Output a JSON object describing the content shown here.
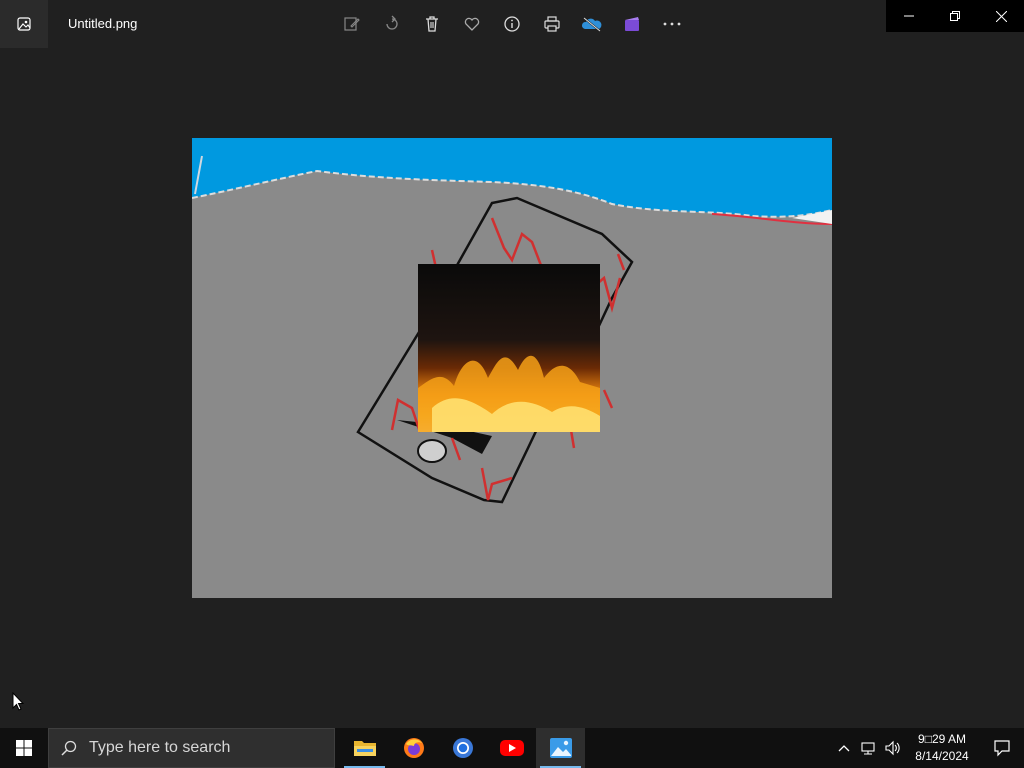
{
  "window": {
    "file_name": "Untitled.png",
    "toolbar": [
      "edit-icon",
      "rotate-icon",
      "delete-icon",
      "favorite-icon",
      "info-icon",
      "print-icon",
      "onedrive-icon",
      "clipchamp-icon",
      "more-icon"
    ],
    "controls": [
      "minimize",
      "restore",
      "close"
    ]
  },
  "image": {
    "sky_color": "#0099e0",
    "ground_color": "#8a8a8a"
  },
  "taskbar": {
    "search_placeholder": "Type here to search",
    "apps": [
      "file-explorer",
      "firefox",
      "chrome",
      "youtube",
      "photos"
    ],
    "time": "9□29 AM",
    "date": "8/14/2024"
  }
}
